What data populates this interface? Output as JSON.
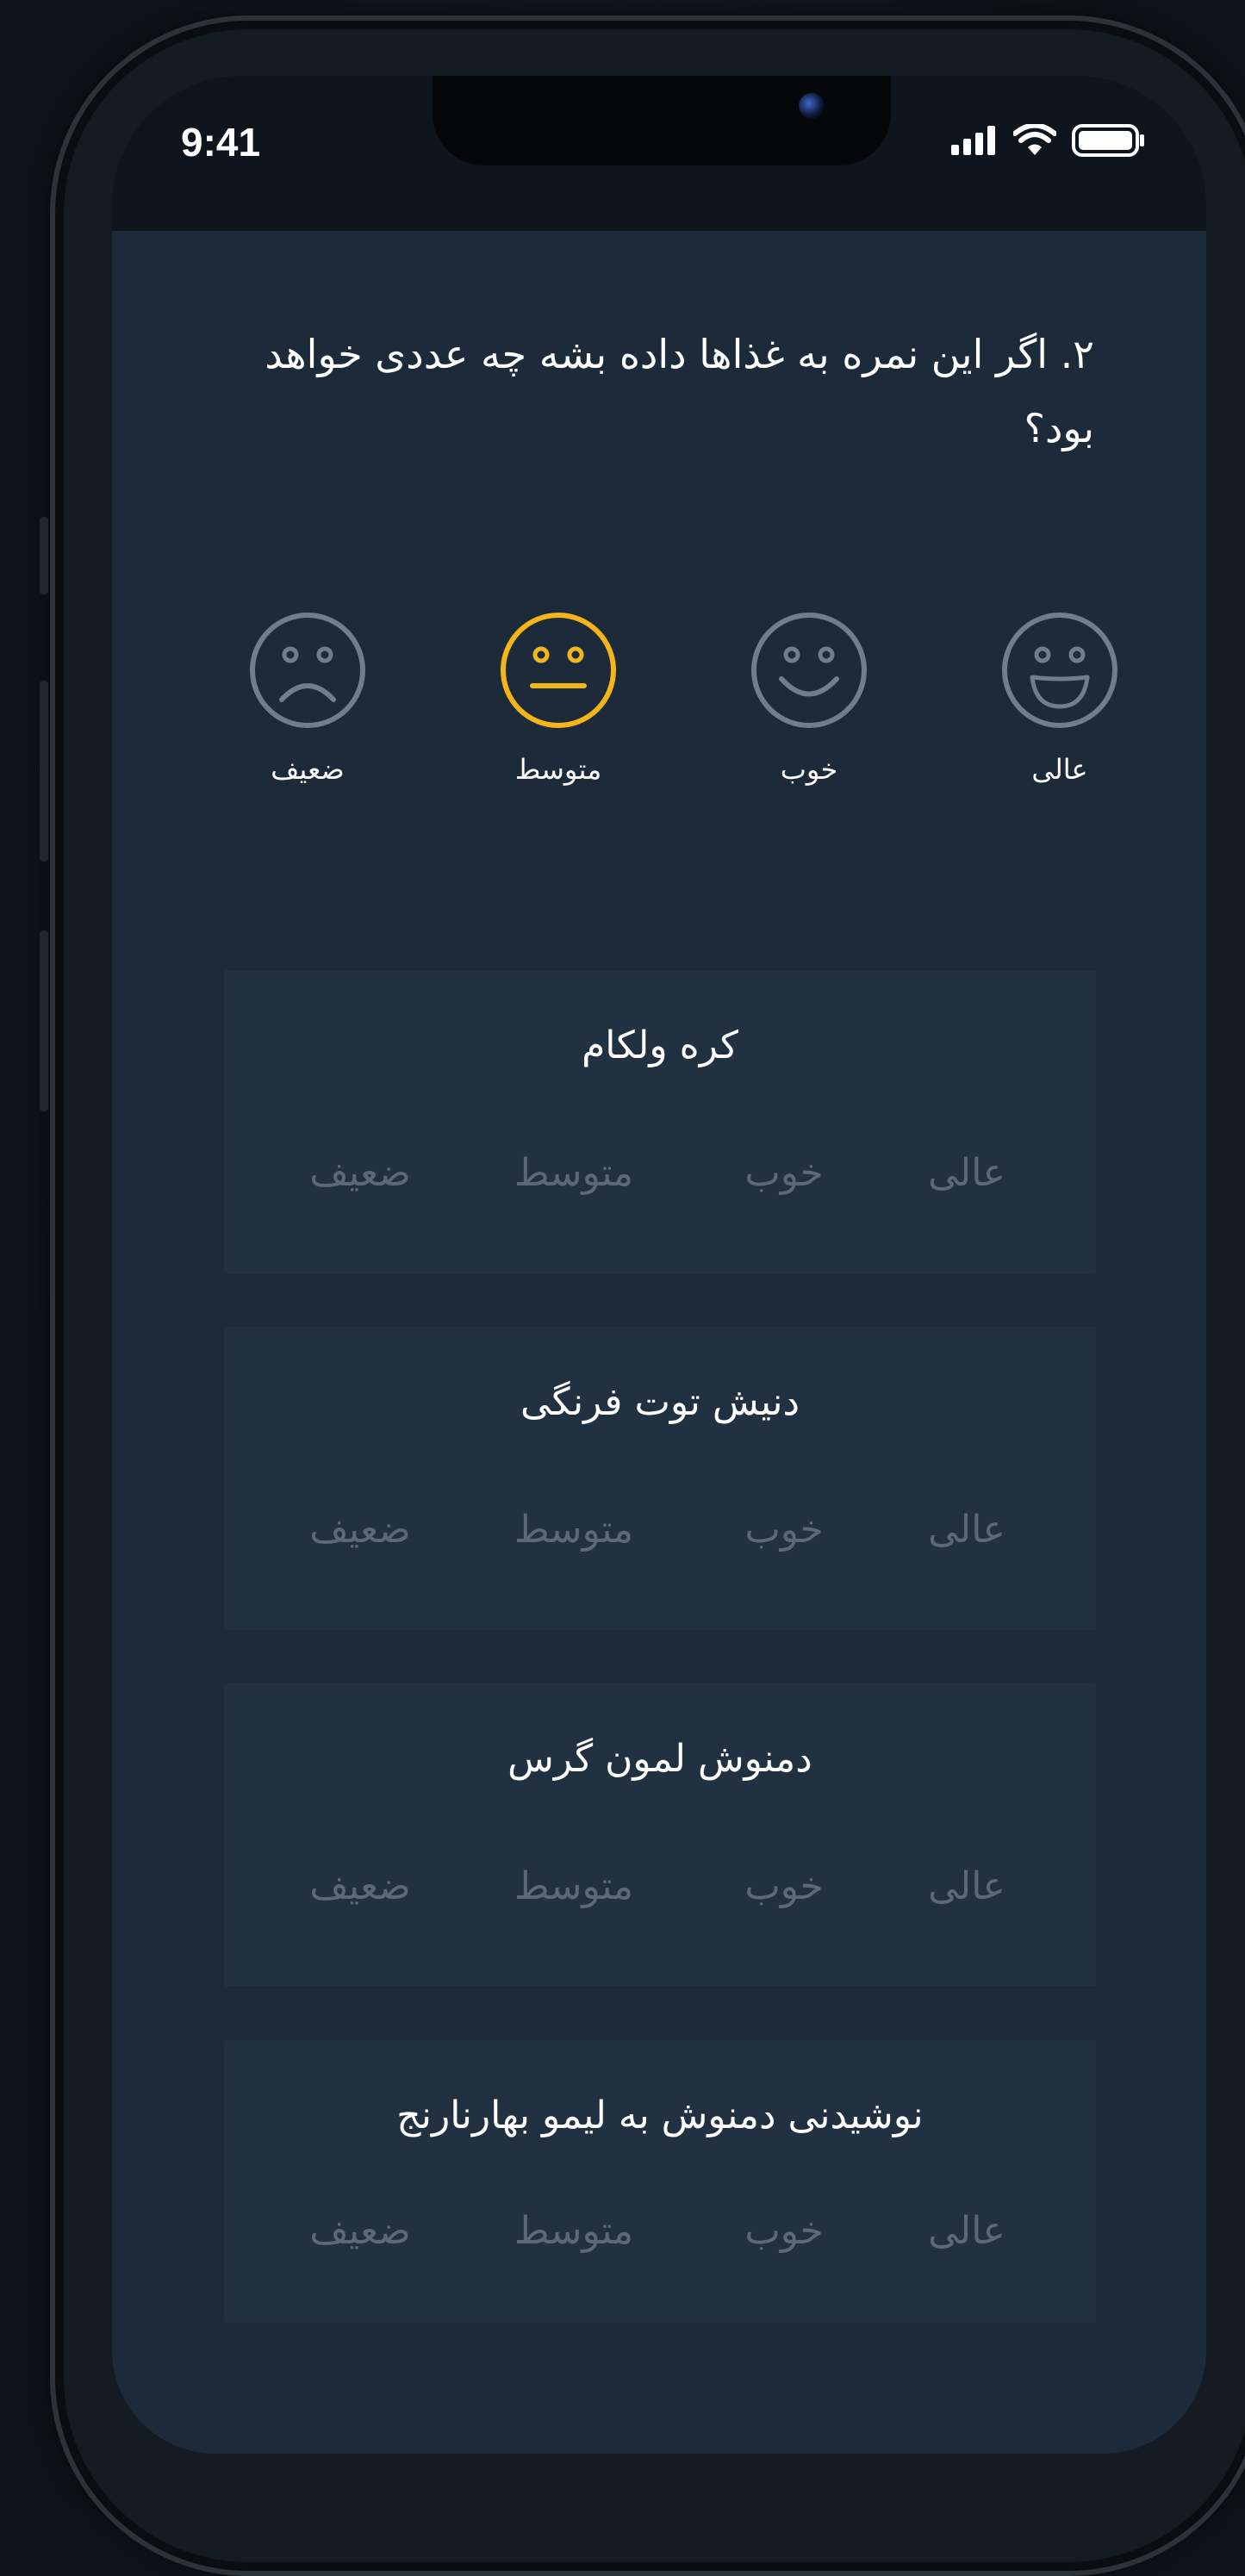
{
  "status_bar": {
    "time": "9:41",
    "icons": [
      "signal-icon",
      "wifi-icon",
      "battery-icon"
    ]
  },
  "question": {
    "text": "۲. اگر این نمره به غذاها داده بشه چه عددی خواهد بود؟"
  },
  "options": [
    {
      "label": "عالی",
      "icon": "laughing-face-icon",
      "selected": false
    },
    {
      "label": "خوب",
      "icon": "smiling-face-icon",
      "selected": false
    },
    {
      "label": "متوسط",
      "icon": "neutral-face-icon",
      "selected": true
    },
    {
      "label": "ضعیف",
      "icon": "sad-face-icon",
      "selected": false
    }
  ],
  "items": [
    {
      "title": "کره ولکام",
      "ratings": [
        "عالی",
        "خوب",
        "متوسط",
        "ضعیف"
      ]
    },
    {
      "title": "دنیش توت فرنگی",
      "ratings": [
        "عالی",
        "خوب",
        "متوسط",
        "ضعیف"
      ]
    },
    {
      "title": "دمنوش لمون گرس",
      "ratings": [
        "عالی",
        "خوب",
        "متوسط",
        "ضعیف"
      ]
    },
    {
      "title": "نوشیدنی دمنوش به لیمو بهارنارنج",
      "ratings": [
        "عالی",
        "خوب",
        "متوسط",
        "ضعیف"
      ]
    }
  ],
  "colors": {
    "accent": "#f5b418",
    "icon_default": "#6f7d8c",
    "background": "#1d2a3a",
    "card": "#223142"
  }
}
